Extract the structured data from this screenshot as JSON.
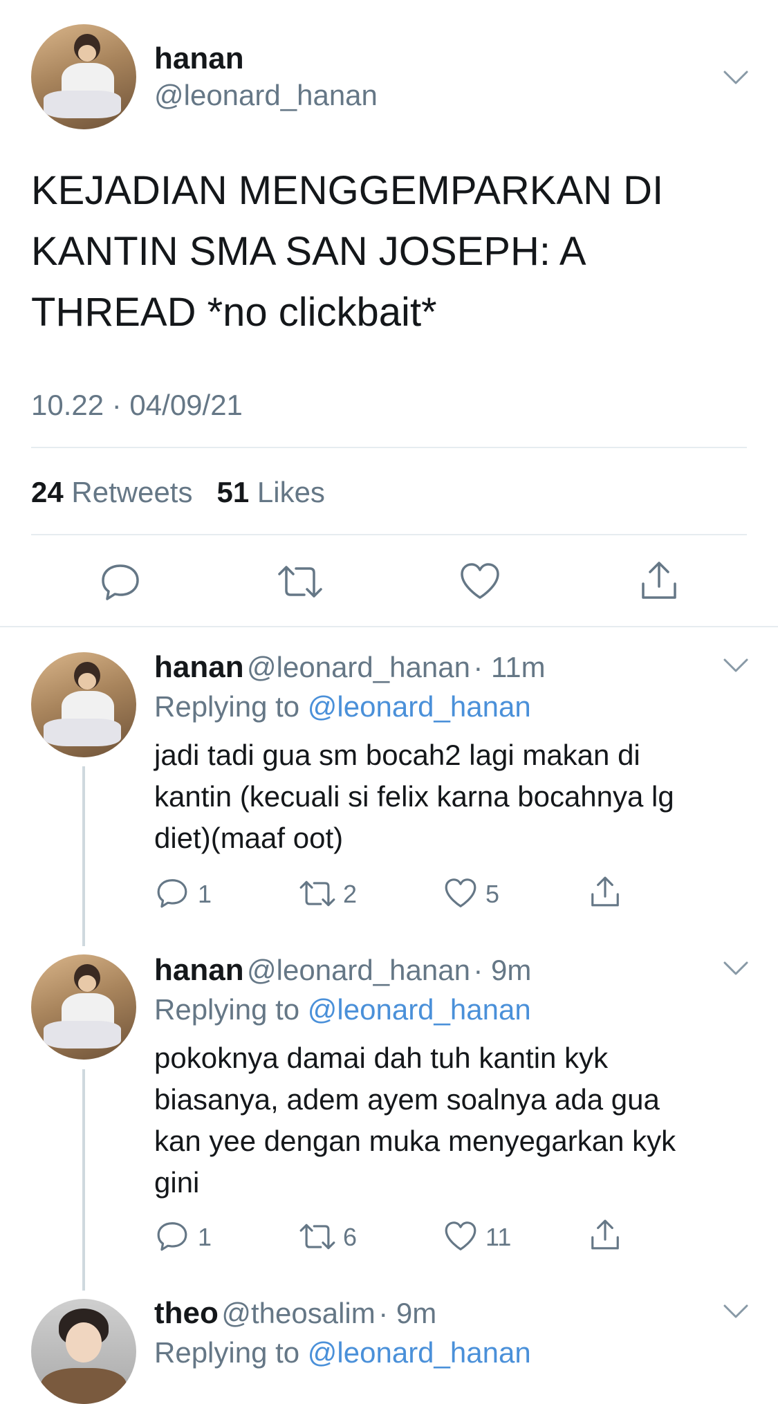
{
  "main_tweet": {
    "name": "hanan",
    "handle": "@leonard_hanan",
    "text_lines": [
      "KEJADIAN MENGGEMPARKAN DI",
      "KANTIN SMA SAN JOSEPH: A",
      "THREAD *no clickbait*"
    ],
    "timestamp": "10.22 · 04/09/21",
    "retweets_count": "24",
    "retweets_label": "Retweets",
    "likes_count": "51",
    "likes_label": "Likes"
  },
  "replies": [
    {
      "name": "hanan",
      "handle": "@leonard_hanan",
      "time": "· 11m",
      "replying_label": "Replying to",
      "replying_to": "@leonard_hanan",
      "text_lines": [
        "jadi tadi gua sm bocah2 lagi makan di",
        "kantin (kecuali si felix karna bocahnya lg",
        "diet)(maaf oot)"
      ],
      "replies_count": "1",
      "retweets_count": "2",
      "likes_count": "5"
    },
    {
      "name": "hanan",
      "handle": "@leonard_hanan",
      "time": "· 9m",
      "replying_label": "Replying to",
      "replying_to": "@leonard_hanan",
      "text_lines": [
        "pokoknya damai dah tuh kantin kyk",
        "biasanya, adem ayem soalnya ada gua",
        "kan yee dengan muka menyegarkan kyk",
        "gini"
      ],
      "replies_count": "1",
      "retweets_count": "6",
      "likes_count": "11"
    },
    {
      "name": "theo",
      "handle": "@theosalim",
      "time": "· 9m",
      "replying_label": "Replying to",
      "replying_to": "@leonard_hanan"
    }
  ],
  "colors": {
    "text": "#14171a",
    "secondary": "#657786",
    "link": "#4a90d9",
    "divider": "#e6ecf0"
  },
  "icons": [
    "chevron-down-icon",
    "reply-icon",
    "retweet-icon",
    "like-icon",
    "share-icon"
  ]
}
